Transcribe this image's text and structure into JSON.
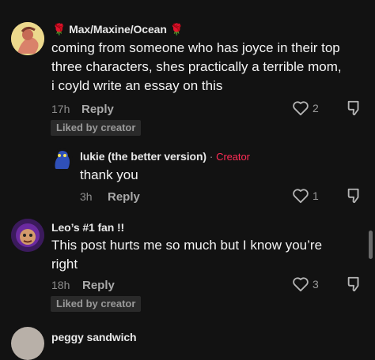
{
  "comments": [
    {
      "username": "Max/Maxine/Ocean",
      "badge_left": "🌹",
      "badge_right": "🌹",
      "text_lines": [
        "coming from someone who has joyce in their top",
        "three characters, shes practically a terrible mom,",
        "i coyld write an essay on this"
      ],
      "time": "17h",
      "reply_label": "Reply",
      "like_count": "2",
      "liked_badge": "Liked by creator"
    },
    {
      "username": "lukie (the better version)",
      "separator": "·",
      "creator_label": "Creator",
      "text": "thank you",
      "time": "3h",
      "reply_label": "Reply",
      "like_count": "1"
    },
    {
      "username": "Leo’s #1 fan !!",
      "text_lines": [
        "This post hurts me so much but I know you’re",
        "right"
      ],
      "time": "18h",
      "reply_label": "Reply",
      "like_count": "3",
      "liked_badge": "Liked by creator"
    },
    {
      "username": "peggy sandwich"
    }
  ],
  "colors": {
    "background": "#121212",
    "creator_accent": "#fe2c55"
  },
  "icons": {
    "like": "heart-outline-icon",
    "dislike": "thumbs-down-icon"
  }
}
